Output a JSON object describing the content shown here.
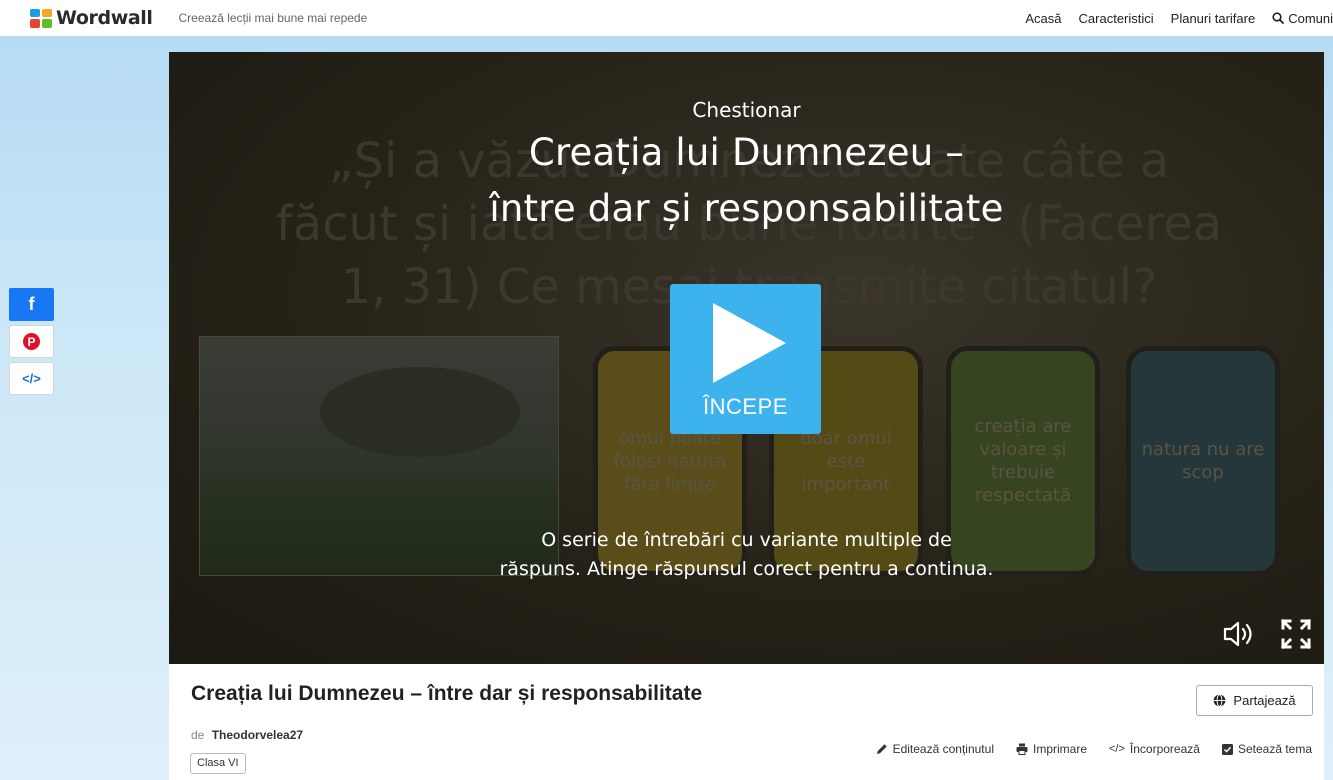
{
  "header": {
    "logo_text": "Wordwall",
    "tagline": "Creează lecții mai bune mai repede",
    "nav": [
      "Acasă",
      "Caracteristici",
      "Planuri tarifare",
      "Comuni"
    ],
    "logo_colors": [
      "#1a9fe0",
      "#f5a623",
      "#e8442e",
      "#5cbf2a"
    ]
  },
  "share_sidebar": {
    "facebook_icon": "f",
    "pinterest_icon": "P",
    "embed_icon": "</>"
  },
  "game": {
    "type_label": "Chestionar",
    "title_line1": "Creația lui Dumnezeu –",
    "title_line2": "între dar și responsabilitate",
    "start_label": "ÎNCEPE",
    "description_line1": "O serie de întrebări cu variante multiple de",
    "description_line2": "răspuns. Atinge răspunsul corect pentru a continua.",
    "background_question_line1": "„Și a văzut Dumnezeu toate câte a",
    "background_question_line2": "făcut și iată erau bune foarte” (Facerea",
    "background_question_line3": "1, 31) Ce mesaj transmite citatul?",
    "background_answers": [
      "omul poate folosi natura fără limite",
      "doar omul este important",
      "creația are valoare și trebuie respectată",
      "natura nu are scop"
    ],
    "answer_card_colors": [
      "#6b5a1e",
      "#5d5318",
      "#3c4a22",
      "#2a3a3c"
    ],
    "accent": "#3db3ee"
  },
  "activity": {
    "title": "Creația lui Dumnezeu – între dar și responsabilitate",
    "by_prefix": "de",
    "author": "Theodorvelea27",
    "tag": "Clasa VI",
    "share_label": "Partajează",
    "actions": [
      "Editează conținutul",
      "Imprimare",
      "Încorporează",
      "Setează tema"
    ]
  }
}
